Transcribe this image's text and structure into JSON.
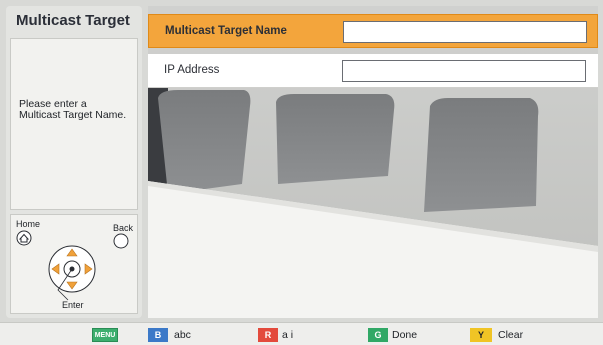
{
  "page": {
    "title": "Multicast Target",
    "help_text": "Please enter a Multicast Target Name."
  },
  "form": {
    "fields": [
      {
        "label": "Multicast Target Name",
        "value": ""
      },
      {
        "label": "IP Address",
        "value": ""
      }
    ]
  },
  "remote": {
    "home_label": "Home",
    "back_label": "Back",
    "enter_label": "Enter"
  },
  "bottom_bar": {
    "menu": {
      "badge": "MENU",
      "color": "#3cae6e"
    },
    "b": {
      "badge": "B",
      "label": "abc",
      "color": "#3c79c8"
    },
    "r": {
      "badge": "R",
      "label": "a i",
      "color": "#e34a3c"
    },
    "g": {
      "badge": "G",
      "label": "Done",
      "color": "#31a866"
    },
    "y": {
      "badge": "Y",
      "label": "Clear",
      "color": "#f0c425"
    }
  },
  "colors": {
    "selected_row": "#f3a53c",
    "accent_arrows": "#f0a13a"
  }
}
